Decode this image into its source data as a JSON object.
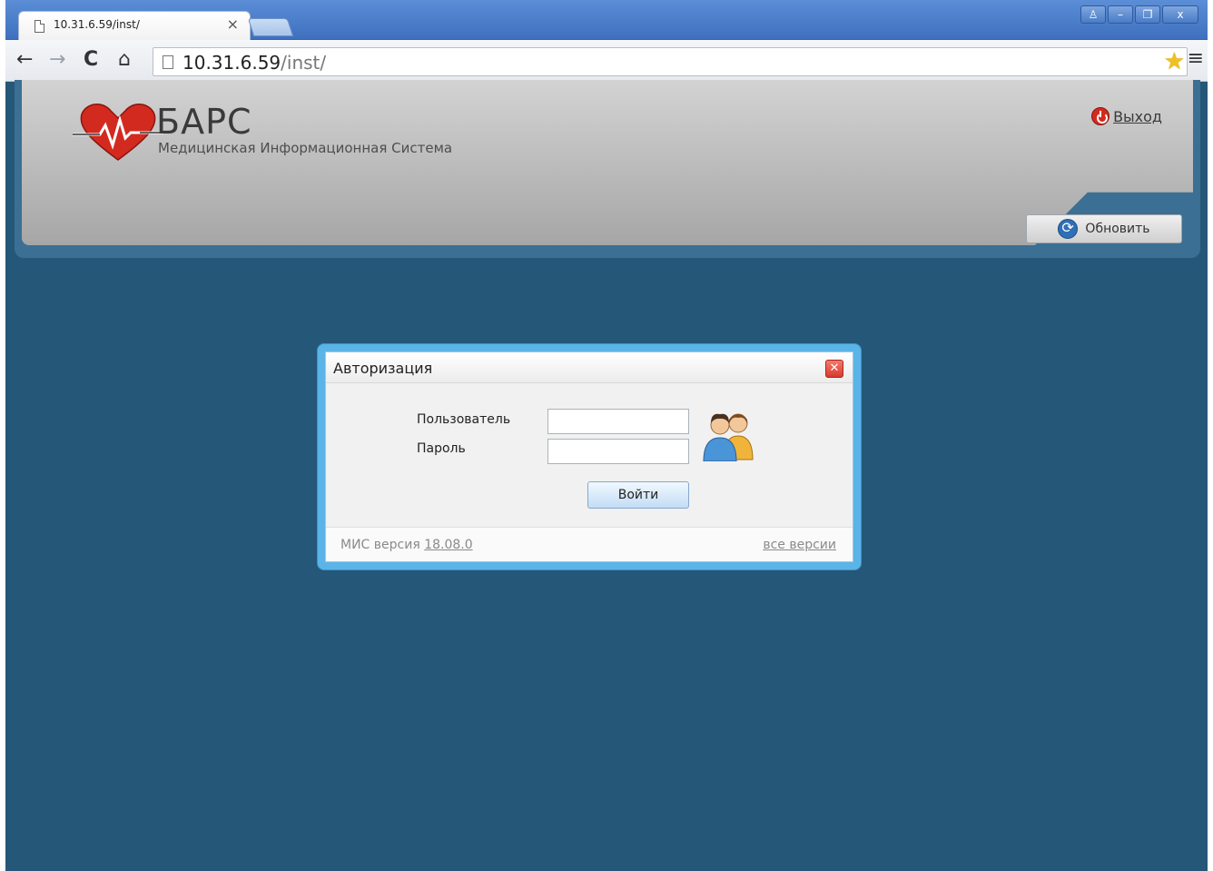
{
  "browser": {
    "tab_title": "10.31.6.59/inst/",
    "tab_close_glyph": "×",
    "url_host": "10.31.6.59",
    "url_path": "/inst/",
    "window_buttons": [
      "♙",
      "–",
      "❐",
      "x"
    ]
  },
  "header": {
    "logo_name": "БАРС",
    "logo_subtitle": "Медицинская Информационная Система",
    "logout_label": "Выход",
    "refresh_label": "Обновить",
    "brand_red": "#d32a1f",
    "page_background": "#255778"
  },
  "dialog": {
    "title": "Авторизация",
    "user_label": "Пользователь",
    "password_label": "Пароль",
    "user_value": "",
    "password_value": "",
    "login_label": "Войти",
    "version_prefix": "МИС версия",
    "version_number": "18.08.0",
    "all_versions_label": "все версии",
    "accent": "#5ab4e8"
  }
}
